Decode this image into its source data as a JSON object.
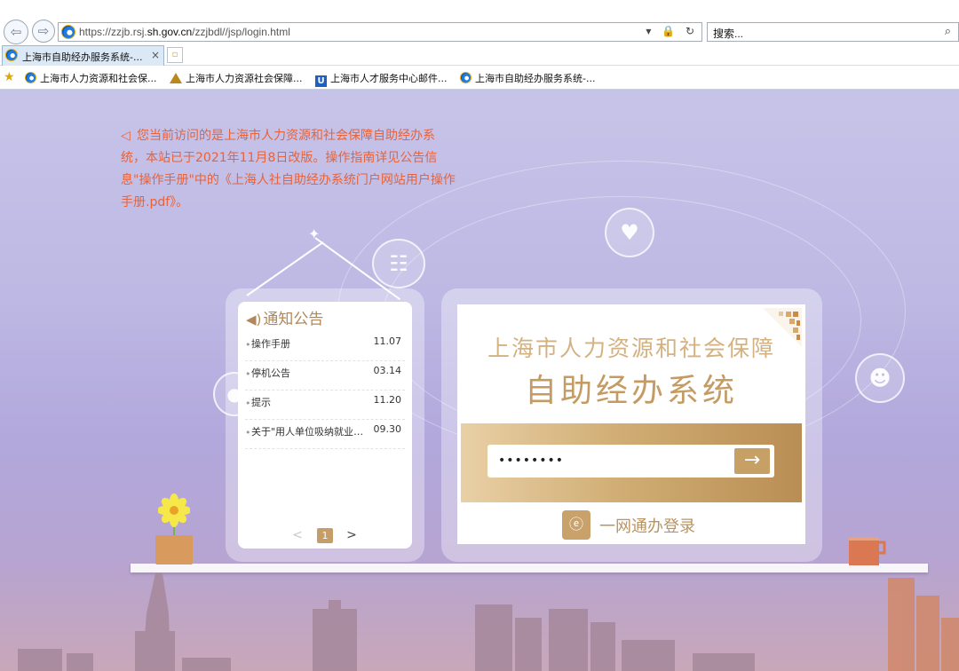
{
  "browser": {
    "url_prefix": "https://zzjb.rsj.",
    "url_domain": "sh.gov.cn",
    "url_path": "/zzjbdl//jsp/login.html",
    "url_tools": "▾ 🔒 ↻",
    "search_placeholder": "搜索...",
    "tab_title": "上海市自助经办服务系统-...",
    "tab_close": "×",
    "favorites": [
      {
        "label": "上海市人力资源和社会保..."
      },
      {
        "label": "上海市人力资源社会保障..."
      },
      {
        "label": "上海市人才服务中心邮件..."
      },
      {
        "label": "上海市自助经办服务系统-..."
      }
    ]
  },
  "notice": {
    "text": "您当前访问的是上海市人力资源和社会保障自助经办系统，本站已于2021年11月8日改版。操作指南详见公告信息\"操作手册\"中的《上海人社自助经办系统门户网站用户操作手册.pdf》。"
  },
  "announcements": {
    "title": "通知公告",
    "items": [
      {
        "title": "操作手册",
        "date": "11.07"
      },
      {
        "title": "停机公告",
        "date": "03.14"
      },
      {
        "title": "提示",
        "date": "11.20"
      },
      {
        "title": "关于\"用人单位吸纳就业困难人员\"",
        "date": "09.30"
      }
    ],
    "pager": {
      "prev": "<",
      "current": "1",
      "next": ">"
    }
  },
  "login": {
    "title_line1": "上海市人力资源和社会保障",
    "title_line2": "自助经办系统",
    "password_value": "••••••••",
    "submit_arrow": "→",
    "yiwang_label": "一网通办登录"
  }
}
